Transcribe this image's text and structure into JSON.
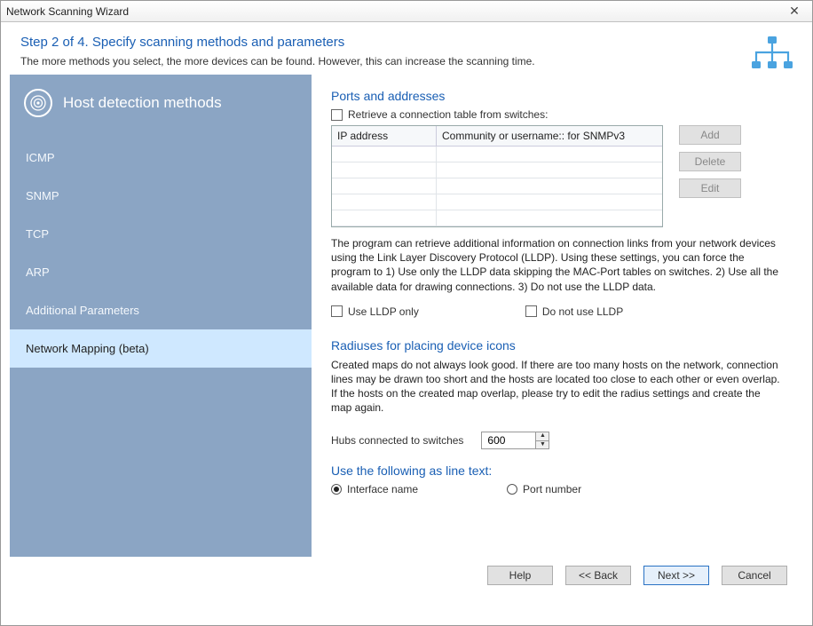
{
  "titlebar": {
    "title": "Network Scanning Wizard"
  },
  "header": {
    "step_title": "Step 2 of 4. Specify scanning methods and parameters",
    "step_desc": "The more methods you select, the more devices can be found. However, this can increase the scanning time."
  },
  "sidebar": {
    "heading": "Host detection methods",
    "items": [
      {
        "label": "ICMP"
      },
      {
        "label": "SNMP"
      },
      {
        "label": "TCP"
      },
      {
        "label": "ARP"
      },
      {
        "label": "Additional Parameters"
      },
      {
        "label": "Network Mapping (beta)"
      }
    ],
    "active_index": 5
  },
  "ports_section": {
    "title": "Ports and addresses",
    "retrieve_label": "Retrieve a connection table from switches:",
    "retrieve_checked": false,
    "table": {
      "col_ip": "IP address",
      "col_comm": "Community or username:: for SNMPv3",
      "rows": []
    },
    "buttons": {
      "add": "Add",
      "delete": "Delete",
      "edit": "Edit"
    },
    "lldp_para": "The program can retrieve additional information on connection links from your network devices using the Link Layer Discovery Protocol (LLDP). Using these settings, you can force the program to 1) Use only the LLDP data skipping the MAC-Port tables on switches. 2) Use all the available data for drawing connections. 3) Do not use the LLDP data.",
    "use_lldp_only": {
      "label": "Use LLDP only",
      "checked": false
    },
    "do_not_use_lldp": {
      "label": "Do not use LLDP",
      "checked": false
    }
  },
  "radiuses_section": {
    "title": "Radiuses for placing device icons",
    "para": "Created maps do not always look good. If there are too many hosts on the network, connection lines may be drawn too short and the hosts are located too close to each other or even overlap. If the hosts on the created map overlap, please try to edit the radius settings and create the map again.",
    "hubs_label": "Hubs connected to switches",
    "hubs_value": "600"
  },
  "line_text_section": {
    "title": "Use the following as line text:",
    "interface_name": "Interface name",
    "port_number": "Port number",
    "selected": "interface_name"
  },
  "footer": {
    "help": "Help",
    "back": "<< Back",
    "next": "Next >>",
    "cancel": "Cancel"
  }
}
